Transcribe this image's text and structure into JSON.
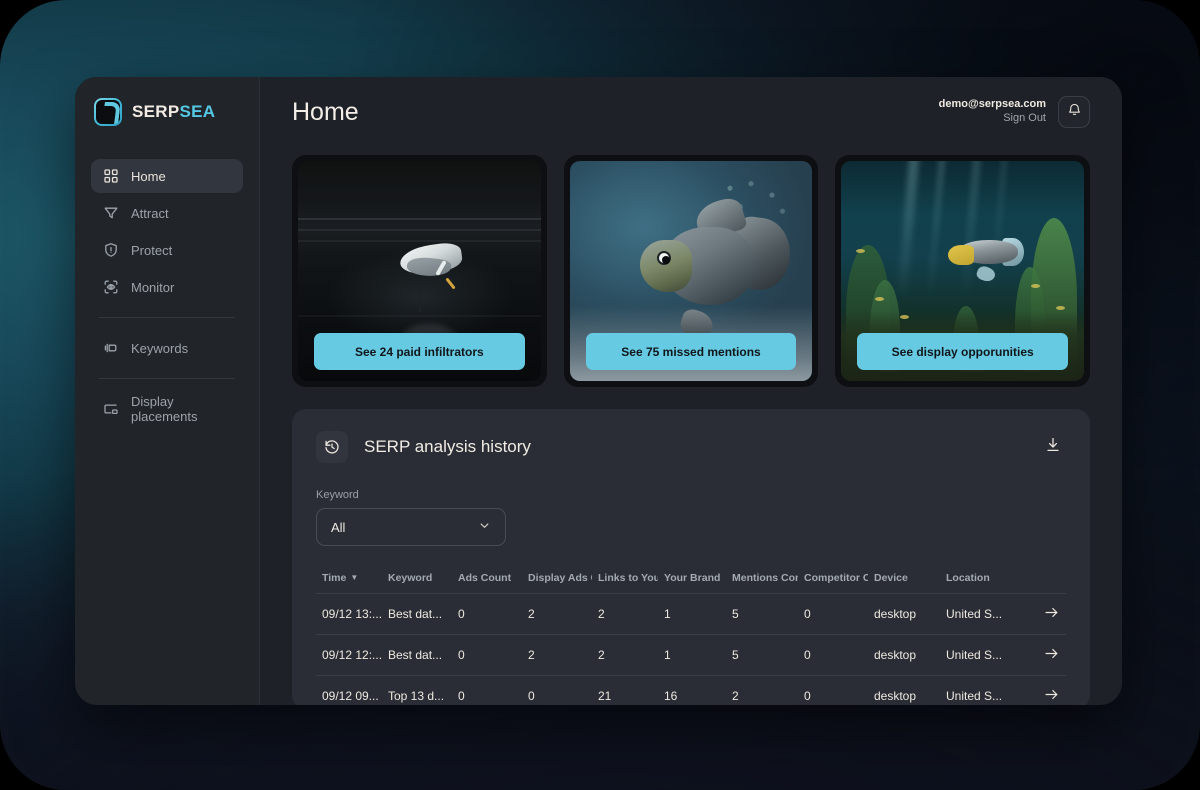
{
  "app": {
    "title": "Home"
  },
  "brand": {
    "logo_icon": "serpsea-logo-icon",
    "name_first": "SERP",
    "name_second": "SEA"
  },
  "sidebar": {
    "items": [
      {
        "label": "Home",
        "icon": "grid-icon",
        "active": true
      },
      {
        "label": "Attract",
        "icon": "funnel-icon",
        "active": false
      },
      {
        "label": "Protect",
        "icon": "shield-icon",
        "active": false
      },
      {
        "label": "Monitor",
        "icon": "scan-eye-icon",
        "active": false
      },
      {
        "label": "Keywords",
        "icon": "megaphone-icon",
        "active": false
      },
      {
        "label": "Display placements",
        "icon": "display-icon",
        "active": false
      }
    ]
  },
  "account": {
    "email": "demo@serpsea.com",
    "sign_out_label": "Sign Out",
    "bell_icon": "bell-icon"
  },
  "promos": [
    {
      "cta_label": "See 24 paid infiltrators",
      "art": "egret-in-dark-water"
    },
    {
      "cta_label": "See 75 missed mentions",
      "art": "goldfish-closeup"
    },
    {
      "cta_label": "See display opporunities",
      "art": "planted-aquarium"
    }
  ],
  "history": {
    "icon": "history-clock-icon",
    "title": "SERP analysis history",
    "download_icon": "download-icon",
    "filter": {
      "label": "Keyword",
      "value": "All",
      "chevron_icon": "chevron-down-icon"
    },
    "columns": [
      "Time",
      "Keyword",
      "Ads Count",
      "Display Ads C",
      "Links to Your ",
      "Your Brand",
      "Mentions Con",
      "Competitor C",
      "Device",
      "Location",
      ""
    ],
    "sorted_column": "Time",
    "rows": [
      {
        "time": "09/12 13:...",
        "keyword": "Best dat...",
        "ads_count": "0",
        "display_ads": "2",
        "links_to_your": "2",
        "your_brand": "1",
        "mentions": "5",
        "competitor": "0",
        "device": "desktop",
        "location": "United S...",
        "go_icon": "arrow-right-icon"
      },
      {
        "time": "09/12 12:...",
        "keyword": "Best dat...",
        "ads_count": "0",
        "display_ads": "2",
        "links_to_your": "2",
        "your_brand": "1",
        "mentions": "5",
        "competitor": "0",
        "device": "desktop",
        "location": "United S...",
        "go_icon": "arrow-right-icon"
      },
      {
        "time": "09/12 09...",
        "keyword": "Top 13 d...",
        "ads_count": "0",
        "display_ads": "0",
        "links_to_your": "21",
        "your_brand": "16",
        "mentions": "2",
        "competitor": "0",
        "device": "desktop",
        "location": "United S...",
        "go_icon": "arrow-right-icon"
      }
    ]
  },
  "colors": {
    "accent": "#66cbe2",
    "panel": "#1e2127",
    "card": "#2a2d35",
    "text": "#efe9e1",
    "muted": "#9aa0a8",
    "backdrop_teal": "#1d5767"
  }
}
